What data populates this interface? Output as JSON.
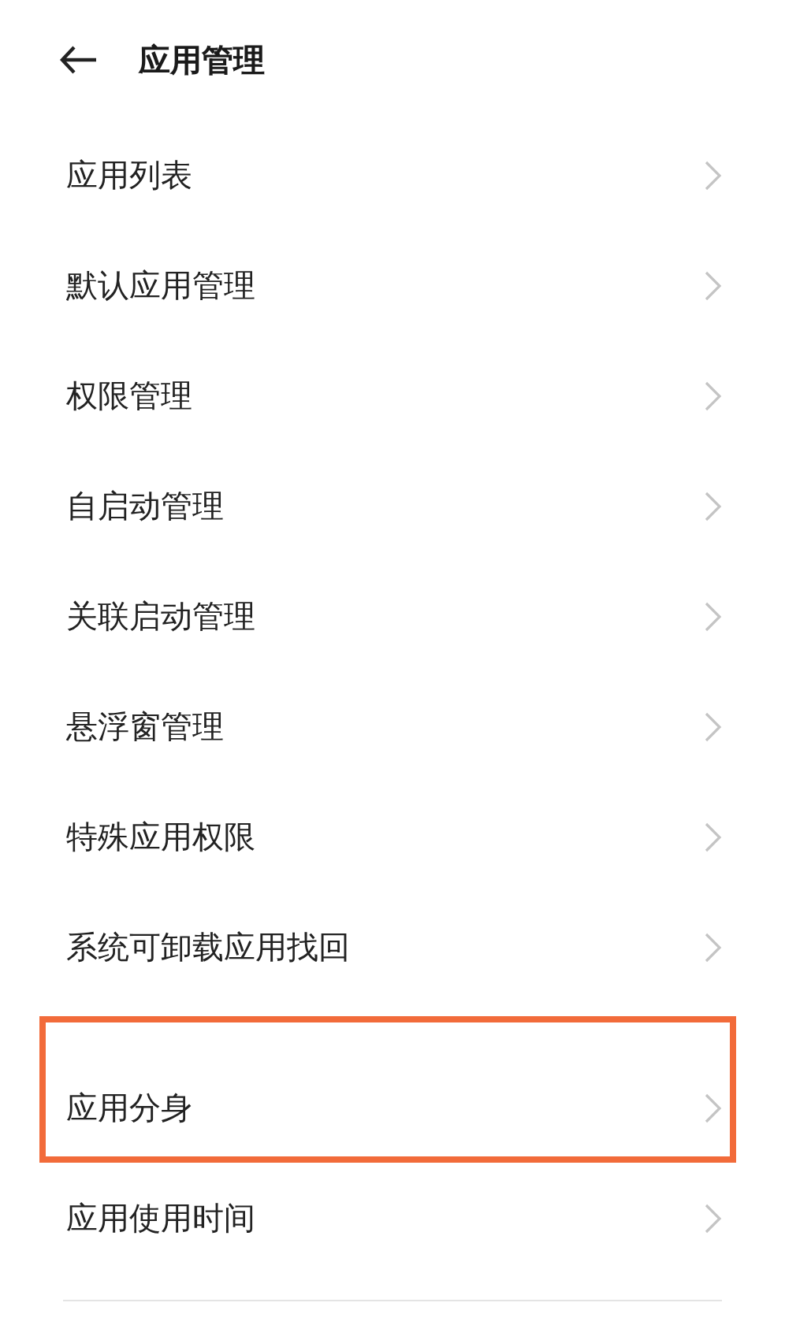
{
  "header": {
    "title": "应用管理"
  },
  "items": [
    {
      "label": "应用列表",
      "highlighted": false
    },
    {
      "label": "默认应用管理",
      "highlighted": false
    },
    {
      "label": "权限管理",
      "highlighted": false
    },
    {
      "label": "自启动管理",
      "highlighted": false
    },
    {
      "label": "关联启动管理",
      "highlighted": false
    },
    {
      "label": "悬浮窗管理",
      "highlighted": false
    },
    {
      "label": "特殊应用权限",
      "highlighted": false
    },
    {
      "label": "系统可卸载应用找回",
      "highlighted": false
    },
    {
      "label": "应用分身",
      "highlighted": true
    },
    {
      "label": "应用使用时间",
      "highlighted": false
    }
  ]
}
